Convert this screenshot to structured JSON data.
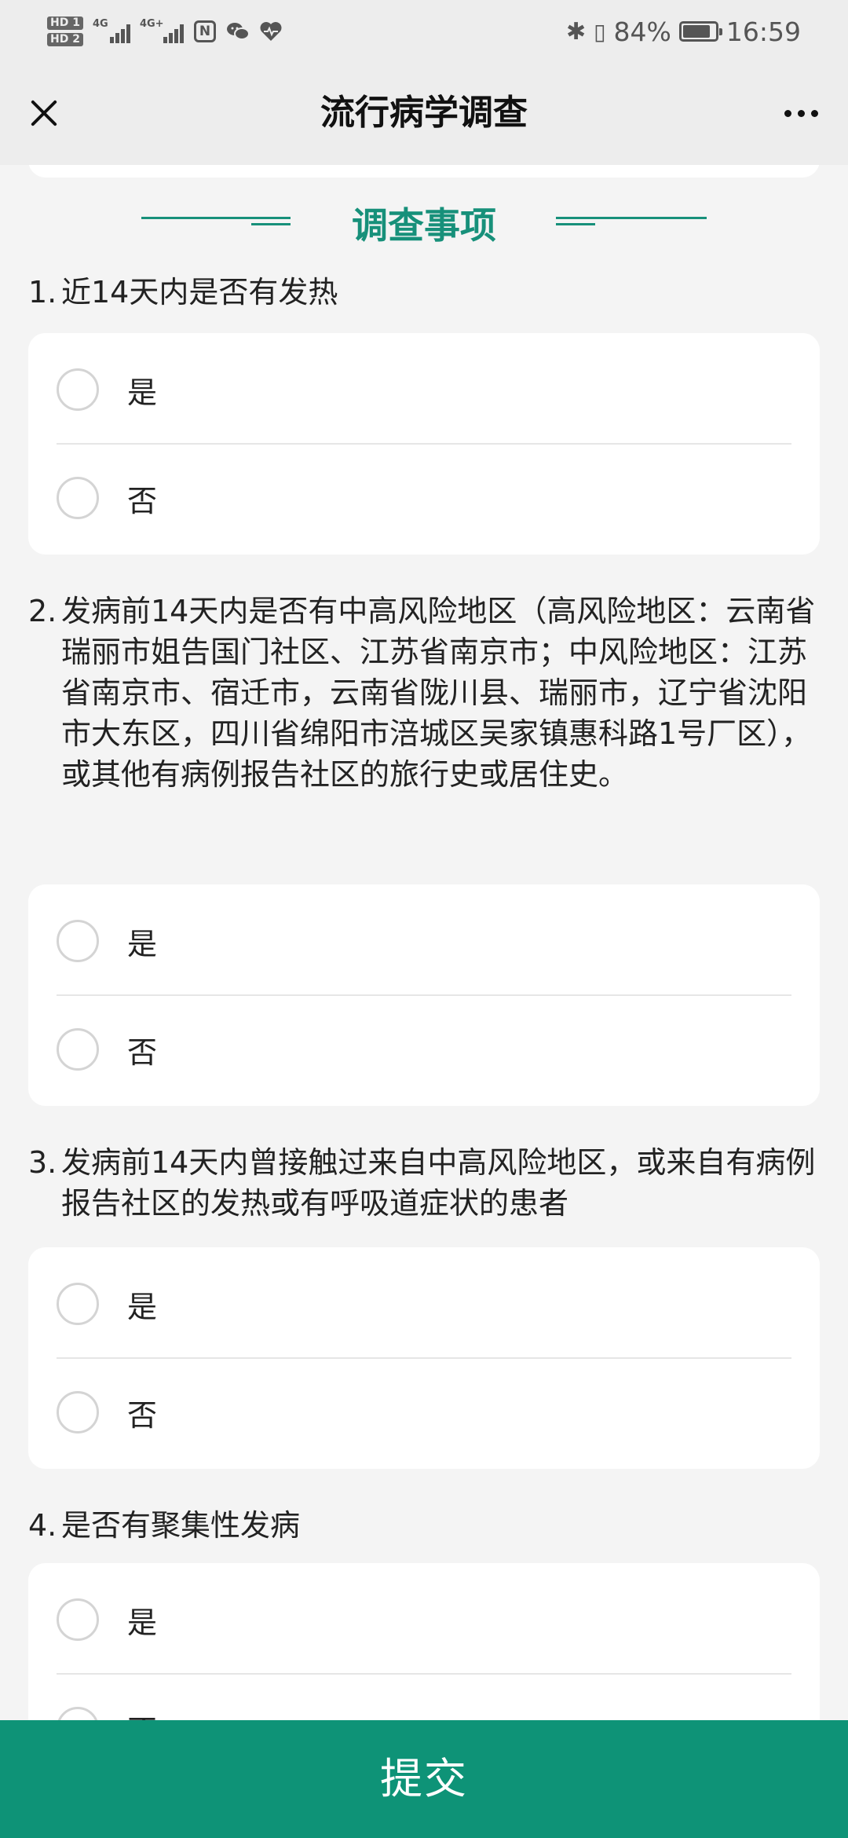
{
  "status_bar": {
    "hd1": "HD 1",
    "hd2": "HD 2",
    "sim1_tag": "4G",
    "sim2_tag": "4G+",
    "icons": [
      "nfc-icon",
      "wechat-icon",
      "health-icon"
    ],
    "battery_percent": "84%",
    "battery_level": 0.84,
    "time": "16:59"
  },
  "navbar": {
    "title": "流行病学调查"
  },
  "section": {
    "title": "调查事项",
    "accent_color": "#17907a"
  },
  "questions": [
    {
      "number": "1.",
      "text": "近14天内是否有发热",
      "options": [
        "是",
        "否"
      ]
    },
    {
      "number": "2.",
      "text": "发病前14天内是否有中高风险地区（高风险地区：云南省瑞丽市姐告国门社区、江苏省南京市；中风险地区：江苏省南京市、宿迁市，云南省陇川县、瑞丽市，辽宁省沈阳市大东区，四川省绵阳市涪城区吴家镇惠科路1号厂区），或其他有病例报告社区的旅行史或居住史。",
      "options": [
        "是",
        "否"
      ]
    },
    {
      "number": "3.",
      "text": "发病前14天内曾接触过来自中高风险地区，或来自有病例报告社区的发热或有呼吸道症状的患者",
      "options": [
        "是",
        "否"
      ]
    },
    {
      "number": "4.",
      "text": "是否有聚集性发病",
      "options": [
        "是",
        "否"
      ]
    }
  ],
  "submit": {
    "label": "提交",
    "color": "#0e9377"
  }
}
